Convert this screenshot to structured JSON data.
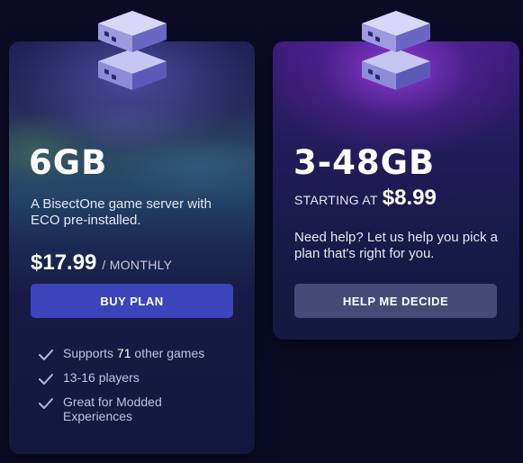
{
  "plans": [
    {
      "icon": "server-stack-icon",
      "title": "6GB",
      "description": "A BisectOne game server with ECO pre-installed.",
      "price": "$17.99",
      "period": "/ MONTHLY",
      "button_label": "BUY PLAN",
      "features": [
        {
          "prefix": "Supports",
          "highlight": "71",
          "suffix": "other games"
        },
        {
          "text": "13-16 players"
        },
        {
          "text": "Great for Modded Experiences"
        }
      ]
    },
    {
      "icon": "server-stack-icon",
      "title": "3-48GB",
      "starting_label": "STARTING AT",
      "starting_price": "$8.99",
      "description": "Need help? Let us help you pick a plan that's right for you.",
      "button_label": "HELP ME DECIDE"
    }
  ],
  "colors": {
    "background": "#0b0b26",
    "buy_button": "#3b44bb",
    "help_button": "#454a78",
    "accent_purple": "#9e3ce6"
  }
}
